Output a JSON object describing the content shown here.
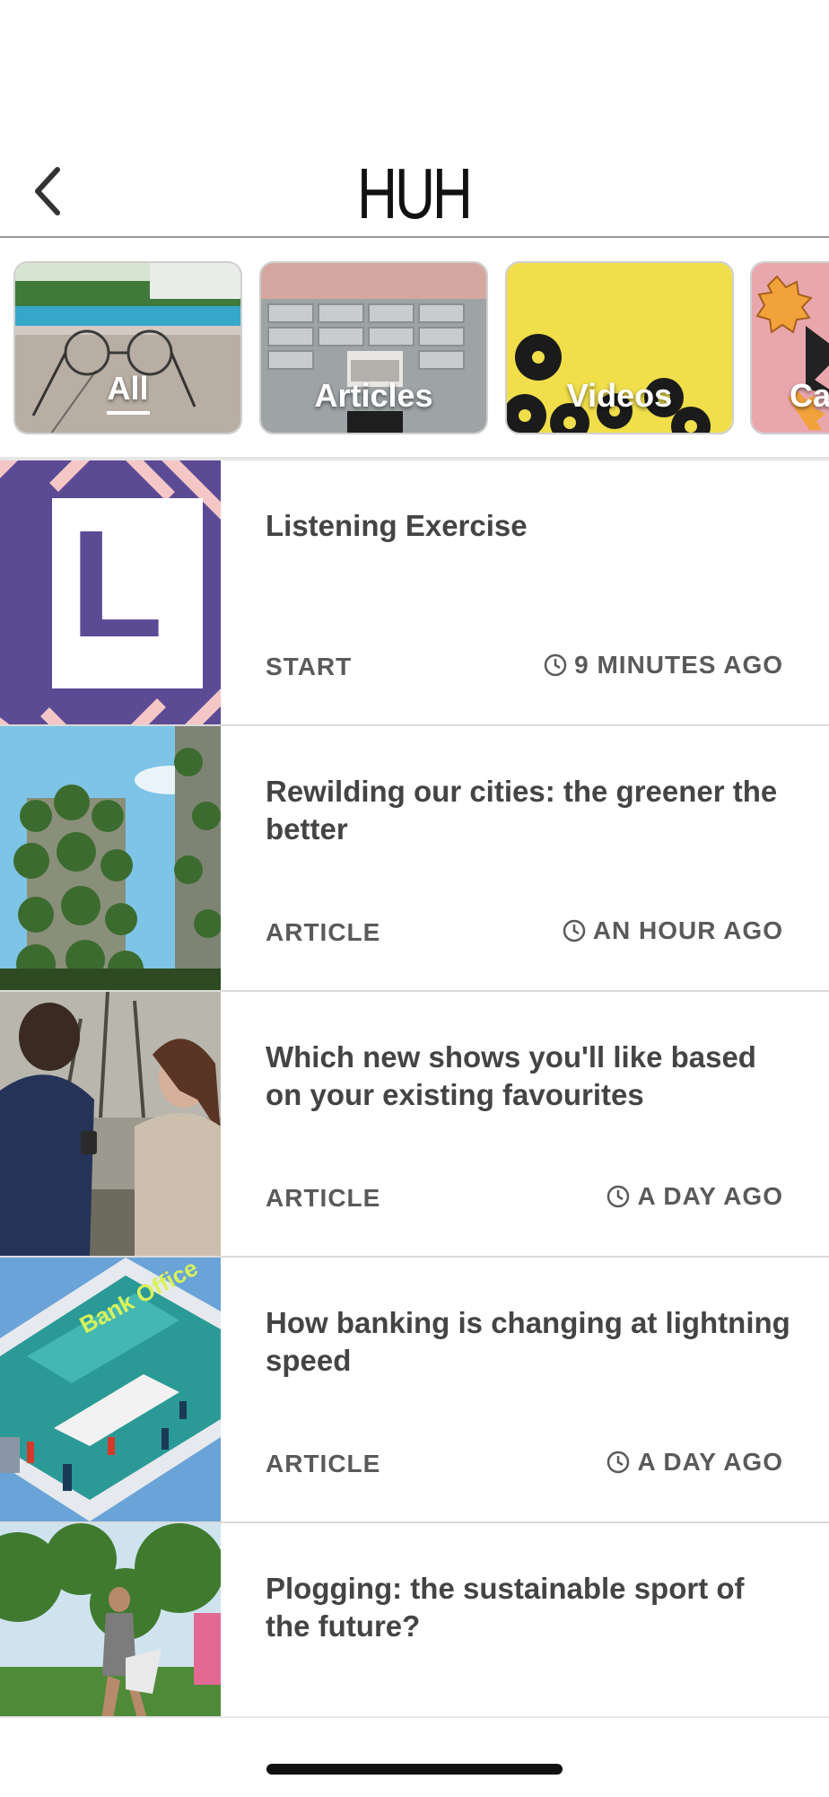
{
  "header": {
    "logo": "HUH",
    "back_icon": "chevron-left-icon"
  },
  "categories": [
    {
      "label": "All",
      "active": true
    },
    {
      "label": "Articles",
      "active": false
    },
    {
      "label": "Videos",
      "active": false
    },
    {
      "label": "Ca",
      "active": false
    }
  ],
  "feed": [
    {
      "title": "Listening Exercise",
      "kind": "START",
      "time": "9 MINUTES AGO"
    },
    {
      "title": "Rewilding our cities: the greener the better",
      "kind": "ARTICLE",
      "time": "AN HOUR AGO"
    },
    {
      "title": "Which new shows you'll like based on your existing favourites",
      "kind": "ARTICLE",
      "time": "A DAY AGO"
    },
    {
      "title": "How banking is changing at lightning speed",
      "kind": "ARTICLE",
      "time": "A DAY AGO"
    },
    {
      "title": "Plogging: the sustainable sport of the future?",
      "kind": "",
      "time": ""
    }
  ],
  "thumb_texts": {
    "banking_sign": "Bank Office",
    "listening_letter": "L"
  },
  "colors": {
    "accent_purple": "#5b4a94",
    "pink": "#f4c6c6",
    "text": "#444444"
  }
}
